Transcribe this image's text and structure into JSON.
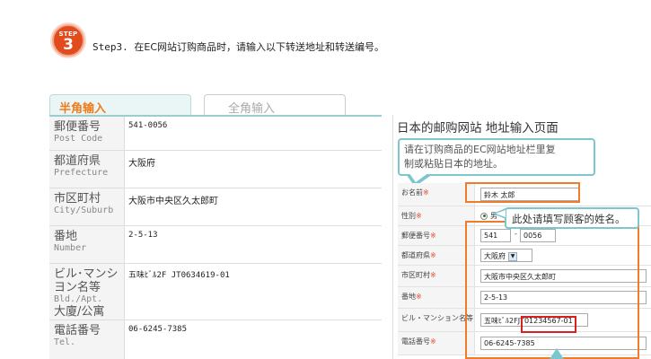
{
  "step": {
    "badge_top": "STEP",
    "badge_number": "3",
    "label": "Step3.",
    "instruction": "在EC网站订购商品时，请输入以下转送地址和转送编号。"
  },
  "tabs": {
    "half_width": "半角输入",
    "full_width": "全角输入"
  },
  "left_form": {
    "rows": [
      {
        "jp": "郵便番号",
        "en": "Post Code",
        "value": "541-0056"
      },
      {
        "jp": "都道府県",
        "en": "Prefecture",
        "value": "大阪府"
      },
      {
        "jp": "市区町村",
        "en": "City/Suburb",
        "value": "大阪市中央区久太郎町"
      },
      {
        "jp": "番地",
        "en": "Number",
        "value": "2-5-13"
      },
      {
        "jp": "ビル･マンシ",
        "jp2": "ヨン名等",
        "en": "Bld./Apt.",
        "en2": "大廈/公寓",
        "value": "五味ﾋﾞﾙ2F JT0634619-01"
      },
      {
        "jp": "電話番号",
        "en": "Tel.",
        "value": "06-6245-7385"
      }
    ]
  },
  "right_panel": {
    "title": "日本的邮购网站 地址输入页面",
    "hint_line1": "请在订购商品的EC网站地址栏里复",
    "hint_line2": "制或粘贴日本的地址。",
    "name_hint": "此处请填写顾客的姓名。",
    "required_mark": "※",
    "fields": {
      "name_label": "お名前",
      "name_value": "鈴木 太郎",
      "gender_label": "性別",
      "gender_value": "男",
      "zip_label": "郵便番号",
      "zip1": "541",
      "zip_sep": "-",
      "zip2": "0056",
      "pref_label": "都道府県",
      "pref_value": "大阪府",
      "city_label": "市区町村",
      "city_value": "大阪市中央区久太郎町",
      "street_label": "番地",
      "street_value": "2-5-13",
      "bldg_label": "ビル・マンション名等",
      "bldg_value_a": "五味ﾋﾞﾙ2F",
      "bldg_value_b": "JT01234567-01",
      "tel_label": "電話番号",
      "tel_value": "06-6245-7385"
    }
  },
  "colors": {
    "accent_orange": "#f07b1a",
    "tab_teal": "#9acdcd",
    "callout_teal": "#7cc6cd",
    "highlight_orange": "#ef7c2a",
    "highlight_red": "#d92020",
    "required_red": "#e5442d",
    "step_badge": "#e14b1d"
  }
}
